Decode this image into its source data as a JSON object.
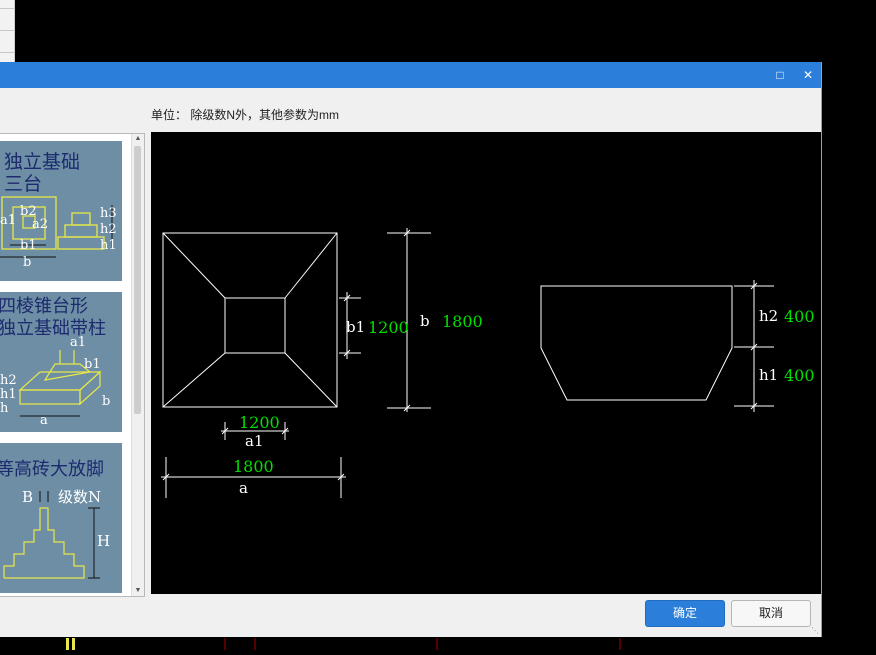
{
  "dialog": {
    "unit_label": "单位： 除级数N外，其他参数为mm",
    "maximize_icon": "maximize-icon",
    "close_icon": "close-icon",
    "ok_label": "确定",
    "cancel_label": "取消"
  },
  "thumbnails": [
    {
      "title_line1": "独立基础",
      "title_line2": "三台",
      "labels": [
        "a1",
        "b2",
        "a2",
        "b1",
        "b",
        "h3",
        "h2",
        "h1"
      ]
    },
    {
      "title_line1": "四棱锥台形",
      "title_line2": "独立基础带柱",
      "labels": [
        "a1",
        "b1",
        "h2",
        "h1",
        "h",
        "a",
        "b"
      ]
    },
    {
      "title_line1": "等高砖大放脚",
      "labels": [
        "B",
        "级数N",
        "H"
      ]
    }
  ],
  "drawing": {
    "a1_value": "1200",
    "a1_label": "a1",
    "a_value": "1800",
    "a_label": "a",
    "b1_label": "b1",
    "b1_value": "1200",
    "b_label": "b",
    "b_value": "1800",
    "h2_label": "h2",
    "h2_value": "400",
    "h1_label": "h1",
    "h1_value": "400"
  },
  "colors": {
    "titlebar": "#2b7fdb",
    "dim_value": "#00e000",
    "line": "#ffffff",
    "thumb_bg": "#6d8ea4",
    "thumb_title": "#1c2a6e",
    "thumb_line": "#e8e84a"
  }
}
